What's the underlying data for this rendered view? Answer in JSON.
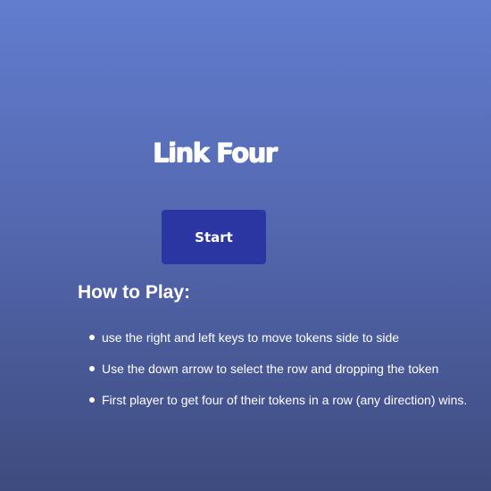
{
  "game": {
    "title": "Link Four",
    "start_label": "Start"
  },
  "instructions": {
    "heading": "How to Play:",
    "items": [
      "use the right and left keys to move tokens side to side",
      "Use the down arrow to select the row and dropping the token",
      "First player to get four of their tokens in a row (any direction) wins."
    ]
  },
  "colors": {
    "background_top": "#627dcf",
    "background_bottom": "#3e4b7e",
    "button": "#2b36a3",
    "text": "#ffffff"
  }
}
